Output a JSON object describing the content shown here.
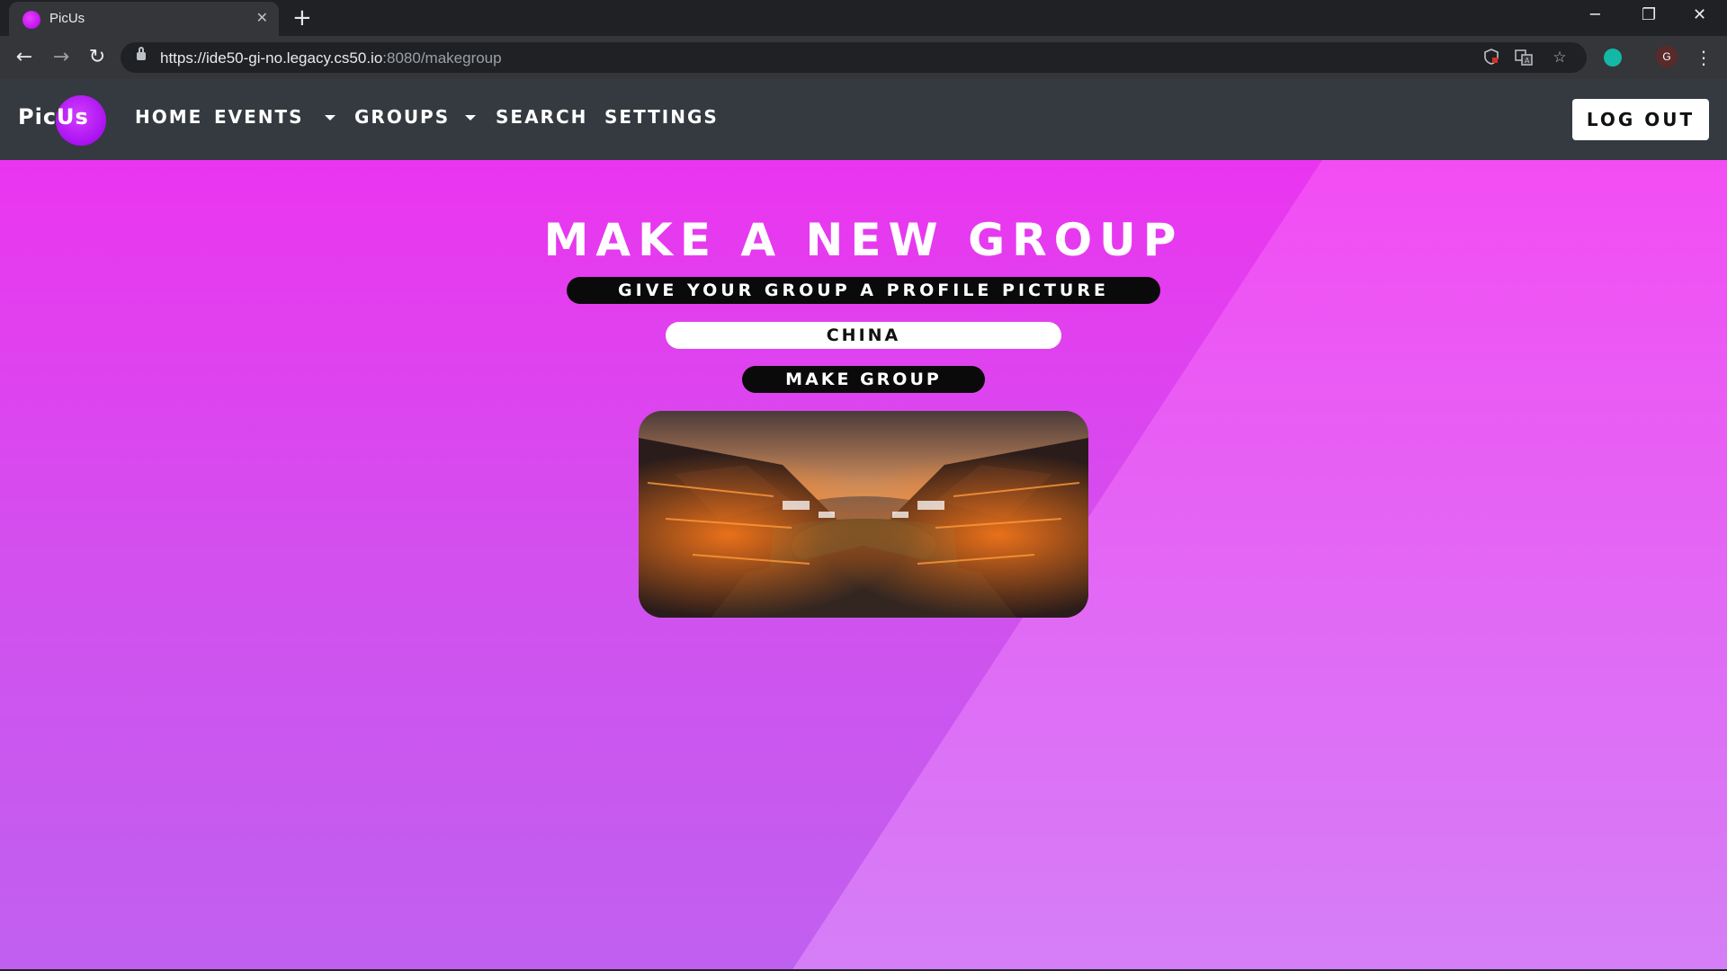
{
  "browser": {
    "tab_title": "PicUs",
    "tab_close": "✕",
    "new_tab": "+",
    "url_host": "https://ide50-gi-no.legacy.cs50.io",
    "url_path": ":8080/makegroup",
    "profile_initial": "G",
    "window_controls": {
      "minimize": "─",
      "restore": "❐",
      "close": "✕"
    },
    "nav": {
      "back": "←",
      "forward": "→",
      "reload": "↻"
    },
    "icons": [
      "security-shield-icon",
      "translate-icon",
      "bookmark-star-icon",
      "extension-icon",
      "profile-avatar",
      "more-menu-icon"
    ]
  },
  "site": {
    "brand": "PicUs",
    "nav": {
      "home": "Home",
      "events": "Events",
      "groups": "Groups",
      "search": "Search",
      "settings": "Settings"
    },
    "logout": "Log Out"
  },
  "main": {
    "title": "Make a New Group",
    "subtitle": "Give your group a profile picture",
    "group_name_value": "China",
    "submit_label": "Make Group",
    "image_alt": "Rooftops of an old Chinese town at dusk"
  },
  "colors": {
    "navbar": "#343a40",
    "page_top": "#f02ff0",
    "page_bottom": "#c060f0",
    "accent": "#b100e8"
  }
}
